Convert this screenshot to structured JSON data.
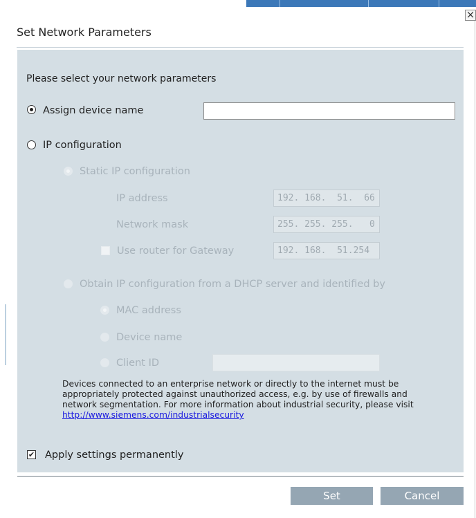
{
  "dialog": {
    "title": "Set Network Parameters",
    "close_glyph": "×",
    "intro": "Please select your network parameters"
  },
  "assign_device_name": {
    "label": "Assign device name",
    "selected": true,
    "value": ""
  },
  "ip_configuration": {
    "label": "IP configuration",
    "selected": false,
    "static": {
      "label": "Static IP configuration",
      "selected": true,
      "ip_address_label": "IP address",
      "ip_address_value": "192. 168.  51.  66",
      "network_mask_label": "Network mask",
      "network_mask_value": "255. 255. 255.   0",
      "router_label": "Use router for Gateway",
      "router_checked": false,
      "gateway_value": "192. 168.  51.254"
    },
    "dhcp": {
      "label": "Obtain IP configuration from a DHCP server and identified by",
      "selected": false,
      "mac_label": "MAC address",
      "device_name_label": "Device name",
      "client_id_label": "Client ID",
      "client_id_value": ""
    }
  },
  "security_note": {
    "text": "Devices connected to an enterprise network or directly to the internet must be appropriately protected against unauthorized access, e.g. by use of firewalls and network segmentation. For more information about industrial security, please visit ",
    "link": "http://www.siemens.com/industrialsecurity"
  },
  "apply_permanently": {
    "label": "Apply settings permanently",
    "checked": true,
    "check_glyph": "✔"
  },
  "buttons": {
    "set": "Set",
    "cancel": "Cancel"
  }
}
